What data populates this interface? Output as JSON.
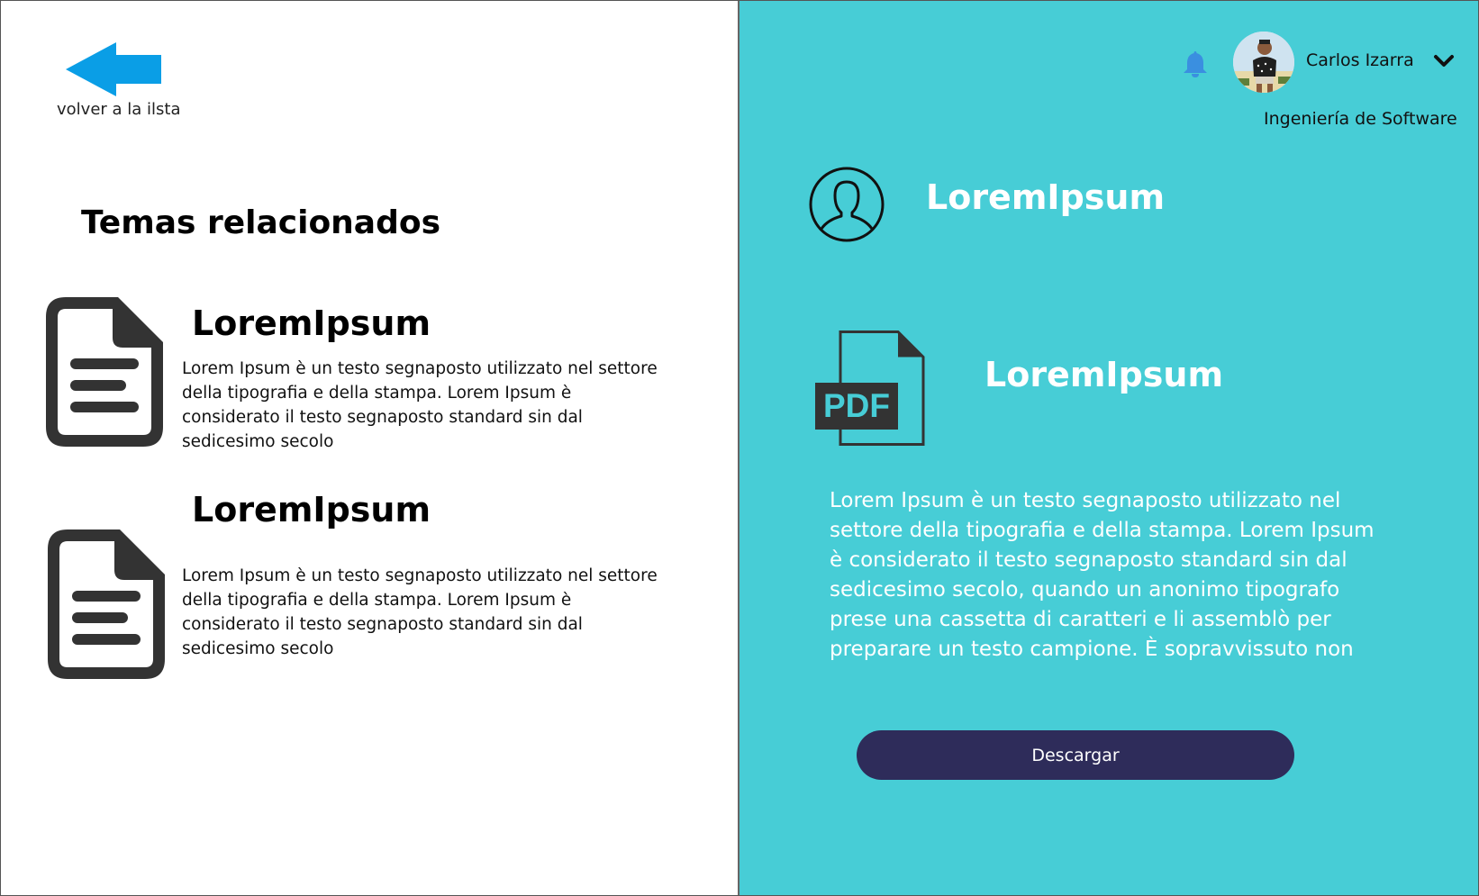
{
  "back": {
    "label": "volver a la ilsta",
    "icon": "arrow-left-icon",
    "color": "#0a9ee6"
  },
  "related": {
    "title": "Temas relacionados",
    "items": [
      {
        "icon": "document-icon",
        "title": "LoremIpsum",
        "description": "Lorem Ipsum è un testo segnaposto utilizzato nel settore della tipografia e della stampa. Lorem Ipsum è considerato il testo segnaposto standard sin dal sedicesimo secolo"
      },
      {
        "icon": "document-icon",
        "title": "LoremIpsum",
        "description": "Lorem Ipsum è un testo segnaposto utilizzato nel settore della tipografia e della stampa. Lorem Ipsum è considerato il testo segnaposto standard sin dal sedicesimo secolo"
      }
    ]
  },
  "user": {
    "name": "Carlos Izarra",
    "career": "Ingeniería de Software",
    "icons": [
      "bell-icon",
      "avatar",
      "chevron-down-icon"
    ]
  },
  "detail": {
    "author_icon": "user-profile-icon",
    "author": "LoremIpsum",
    "file_icon": "pdf-file-icon",
    "file_label": "PDF",
    "title": "LoremIpsum",
    "description": "Lorem Ipsum è un testo segnaposto utilizzato nel settore della tipografia e della stampa. Lorem Ipsum è considerato il testo segnaposto standard sin dal sedicesimo secolo, quando un anonimo tipografo prese una cassetta di caratteri e li assemblò per preparare un testo campione. È sopravvissuto non",
    "download_label": "Descargar"
  },
  "colors": {
    "right_panel_bg": "#47cdd6",
    "button_bg": "#2e2c5a",
    "bell": "#3a8fe0",
    "icon_dark": "#333333"
  }
}
